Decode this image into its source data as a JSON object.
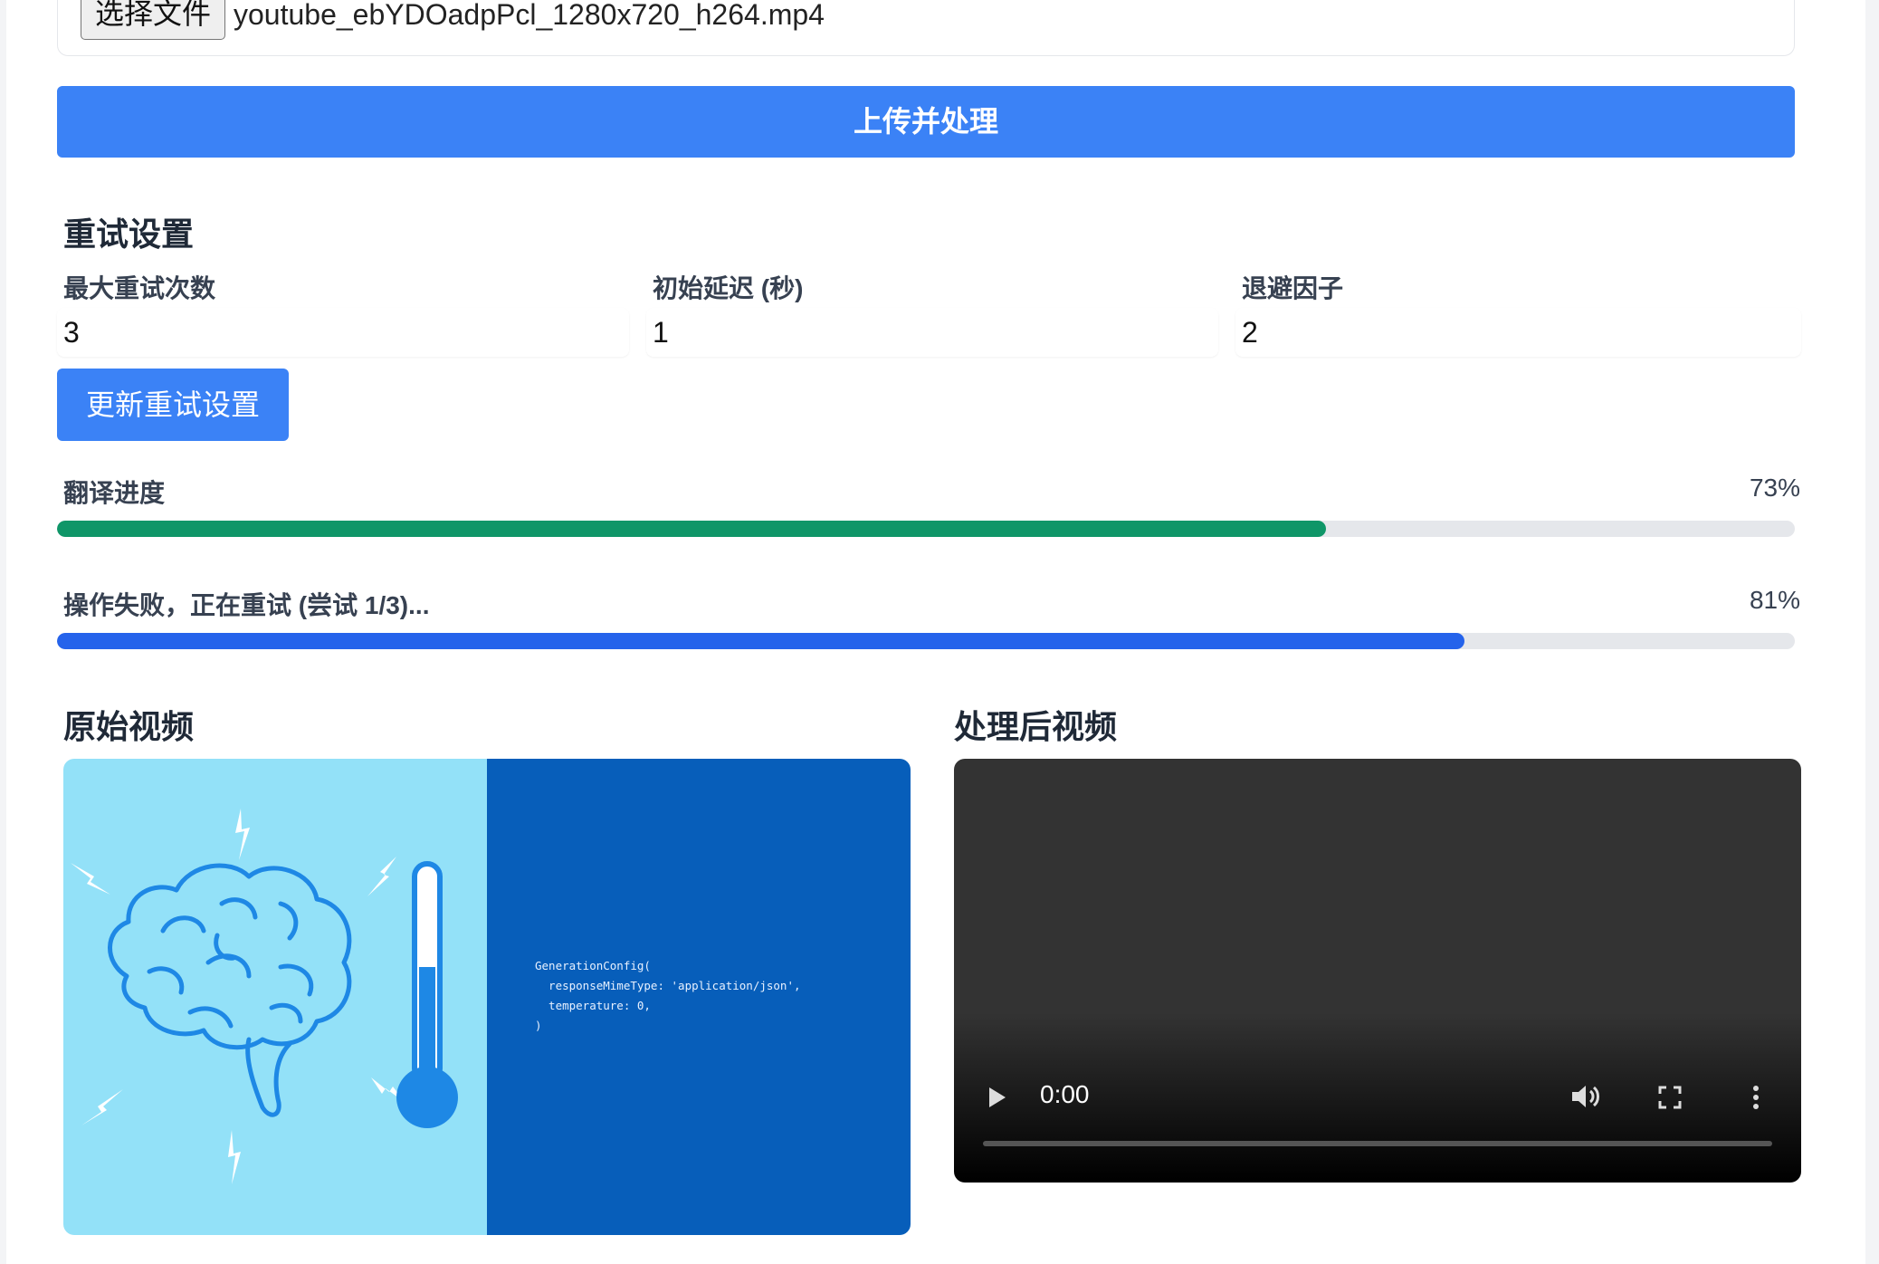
{
  "upload": {
    "choose_file_label": "选择文件",
    "file_name": "youtube_ebYDOadpPcl_1280x720_h264.mp4",
    "submit_label": "上传并处理"
  },
  "retry": {
    "title": "重试设置",
    "max_retries": {
      "label": "最大重试次数",
      "value": "3"
    },
    "initial_delay": {
      "label": "初始延迟 (秒)",
      "value": "1"
    },
    "backoff": {
      "label": "退避因子",
      "value": "2"
    },
    "update_label": "更新重试设置"
  },
  "progress": {
    "translate": {
      "label": "翻译进度",
      "percent_text": "73%",
      "fraction": 0.73,
      "color": "#0f9668"
    },
    "retry": {
      "label": "操作失败，正在重试 (尝试 1/3)...",
      "percent_text": "81%",
      "fraction": 0.81,
      "color": "#2563eb"
    }
  },
  "videos": {
    "original_title": "原始视频",
    "processed_title": "处理后视频",
    "code_text": "GenerationConfig(\n  responseMimeType: 'application/json',\n  temperature: 0,\n)",
    "player_time": "0:00"
  },
  "colors": {
    "accent": "#3b82f6"
  }
}
